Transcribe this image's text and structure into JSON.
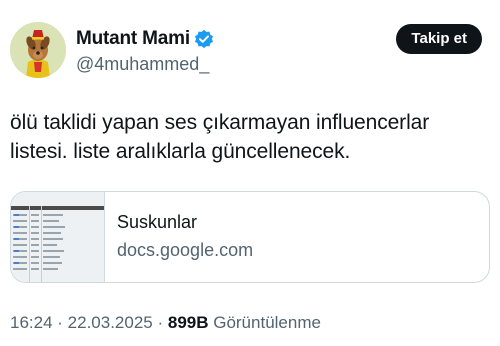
{
  "author": {
    "display_name": "Mutant Mami",
    "handle": "@4muhammed_"
  },
  "follow_label": "Takip et",
  "tweet": {
    "line1": "ölü taklidi yapan ses çıkarmayan influencerlar",
    "line2": "listesi. liste aralıklarla güncellenecek."
  },
  "card": {
    "title": "Suskunlar",
    "domain": "docs.google.com"
  },
  "meta": {
    "time": "16:24",
    "sep1": " · ",
    "date": "22.03.2025",
    "sep2": " · ",
    "views_count": "899B",
    "views_label": " Görüntülenme"
  },
  "colors": {
    "text_primary": "#0f1419",
    "text_secondary": "#536471",
    "verified_blue": "#1d9bf0",
    "border": "#cfd9de"
  },
  "icons": {
    "verified": "verified-badge-icon"
  }
}
